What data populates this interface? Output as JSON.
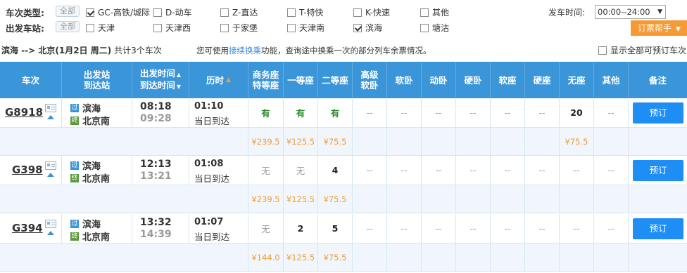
{
  "filters": {
    "type_label": "车次类型:",
    "station_label": "出发车站:",
    "all_label": "全部",
    "train_types": [
      {
        "label": "GC-高铁/城际",
        "checked": true
      },
      {
        "label": "D-动车",
        "checked": false
      },
      {
        "label": "Z-直达",
        "checked": false
      },
      {
        "label": "T-特快",
        "checked": false
      },
      {
        "label": "K-快速",
        "checked": false
      },
      {
        "label": "其他",
        "checked": false
      }
    ],
    "stations": [
      {
        "label": "天津",
        "checked": false
      },
      {
        "label": "天津西",
        "checked": false
      },
      {
        "label": "于家堡",
        "checked": false
      },
      {
        "label": "天津南",
        "checked": false
      },
      {
        "label": "滨海",
        "checked": true
      },
      {
        "label": "塘沽",
        "checked": false
      }
    ],
    "dep_time_label": "发车时间:",
    "dep_time_value": "00:00--24:00",
    "help_label": "订票帮手"
  },
  "summary": {
    "route": "滨海 --> 北京",
    "date": "(1月2日  周二)",
    "count_text": "共计3个车次",
    "note_prefix": "您可使用",
    "note_link": "接续换乘",
    "note_suffix": "功能，查询途中换乘一次的部分列车余票情况。",
    "show_all_label": "显示全部可预订车次"
  },
  "header": {
    "train": "车次",
    "stations_1": "出发站",
    "stations_2": "到达站",
    "times_1": "出发时间",
    "times_2": "到达时间",
    "duration": "历时",
    "business_1": "商务座",
    "business_2": "特等座",
    "first": "一等座",
    "second": "二等座",
    "adv_soft_1": "高级",
    "adv_soft_2": "软卧",
    "soft_sleeper": "软卧",
    "dong_sleeper": "动卧",
    "hard_sleeper": "硬卧",
    "soft_seat": "软座",
    "hard_seat": "硬座",
    "no_seat": "无座",
    "other": "其他",
    "remark": "备注"
  },
  "trains": [
    {
      "no": "G8918",
      "from": "滨海",
      "to": "北京南",
      "from_tag": "过",
      "to_tag": "终",
      "dep": "08:18",
      "arr": "09:28",
      "duration": "01:10",
      "arrive_note": "当日到达",
      "seats": [
        "有",
        "有",
        "有",
        "--",
        "--",
        "--",
        "--",
        "--",
        "--",
        "20",
        "--"
      ],
      "prices": [
        "¥239.5",
        "¥125.5",
        "¥75.5",
        "",
        "",
        "",
        "",
        "",
        "",
        "¥75.5",
        ""
      ],
      "book": "预订"
    },
    {
      "no": "G398",
      "from": "滨海",
      "to": "北京南",
      "from_tag": "过",
      "to_tag": "终",
      "dep": "12:13",
      "arr": "13:21",
      "duration": "01:08",
      "arrive_note": "当日到达",
      "seats": [
        "无",
        "无",
        "4",
        "--",
        "--",
        "--",
        "--",
        "--",
        "--",
        "--",
        "--"
      ],
      "prices": [
        "¥239.5",
        "¥125.5",
        "¥75.5",
        "",
        "",
        "",
        "",
        "",
        "",
        "",
        ""
      ],
      "book": "预订"
    },
    {
      "no": "G394",
      "from": "滨海",
      "to": "北京南",
      "from_tag": "过",
      "to_tag": "终",
      "dep": "13:32",
      "arr": "14:39",
      "duration": "01:07",
      "arrive_note": "当日到达",
      "seats": [
        "无",
        "2",
        "5",
        "--",
        "--",
        "--",
        "--",
        "--",
        "--",
        "--",
        "--"
      ],
      "prices": [
        "¥144.0",
        "¥125.5",
        "¥75.5",
        "",
        "",
        "",
        "",
        "",
        "",
        "",
        ""
      ],
      "book": "预订"
    }
  ]
}
